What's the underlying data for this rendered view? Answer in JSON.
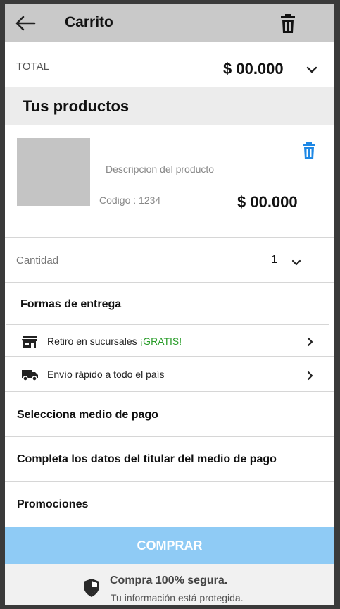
{
  "header": {
    "title": "Carrito",
    "back_icon": "arrow-left-icon",
    "delete_icon": "trash-icon"
  },
  "total": {
    "label": "TOTAL",
    "value": "$ 00.000",
    "toggle_icon": "chevron-down-icon"
  },
  "products_section": {
    "title": "Tus productos",
    "items": [
      {
        "description": "Descripcion del producto",
        "code": "Codigo : 1234",
        "price": "$ 00.000",
        "delete_icon": "trash-icon"
      }
    ]
  },
  "quantity": {
    "label": "Cantidad",
    "value": "1",
    "icon": "chevron-down-icon"
  },
  "delivery": {
    "title": "Formas de entrega",
    "options": [
      {
        "label": "Retiro en sucursales ",
        "highlight": "¡GRATIS!",
        "icon": "store-icon"
      },
      {
        "label": "Envío rápido a todo el país",
        "icon": "truck-icon"
      }
    ]
  },
  "links": {
    "payment_method": "Selecciona medio de pago",
    "holder_data": "Completa los datos del titular del medio de pago",
    "promotions": "Promociones"
  },
  "buy_button": {
    "label": "COMPRAR"
  },
  "footer": {
    "title": "Compra 100% segura.",
    "subtitle": "Tu información está protegida.",
    "icon": "shield-icon"
  },
  "colors": {
    "appbar_bg": "#c9c9c9",
    "section_bg": "#ececec",
    "buy_button_bg": "#8fcbf5",
    "delete_icon_blue": "#1e88e5",
    "free_green": "#2a9d2a"
  }
}
